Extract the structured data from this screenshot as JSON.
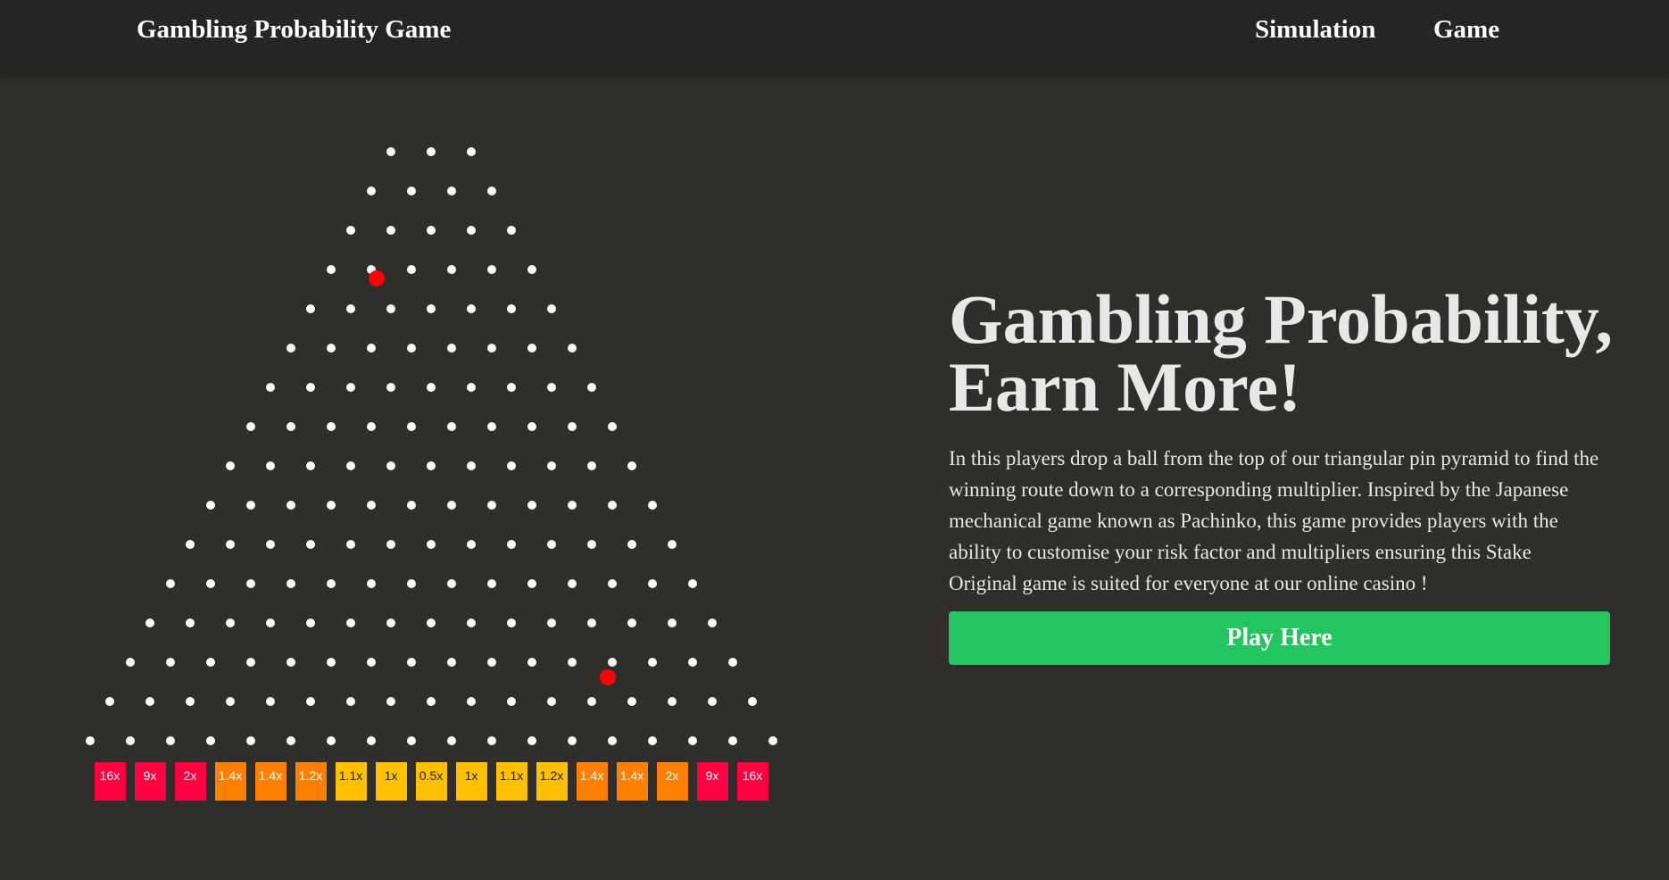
{
  "nav": {
    "brand": "Gambling Probability Game",
    "links": [
      "Simulation",
      "Game"
    ]
  },
  "hero": {
    "title_line1": "Gambling Probability,",
    "title_line2": "Earn More!",
    "description": "In this players drop a ball from the top of our triangular pin pyramid to find the winning route down to a corresponding multiplier. Inspired by the Japanese mechanical game known as Pachinko, this game provides players with the ability to customise your risk factor and multipliers ensuring this Stake Original game is suited for everyone at our online casino !",
    "play_button": "Play Here"
  },
  "board": {
    "rows": 16,
    "pin_color": "#ffffff",
    "ball_color": "#ff0000",
    "ball_count": 2,
    "multipliers": [
      {
        "label": "16x",
        "color": "#ff0040"
      },
      {
        "label": "9x",
        "color": "#ff0040"
      },
      {
        "label": "2x",
        "color": "#ff0040"
      },
      {
        "label": "1.4x",
        "color": "#ff8000"
      },
      {
        "label": "1.4x",
        "color": "#ff8000"
      },
      {
        "label": "1.2x",
        "color": "#ff8000"
      },
      {
        "label": "1.1x",
        "color": "#ffc000"
      },
      {
        "label": "1x",
        "color": "#ffc000"
      },
      {
        "label": "0.5x",
        "color": "#ffc000"
      },
      {
        "label": "1x",
        "color": "#ffc000"
      },
      {
        "label": "1.1x",
        "color": "#ffc000"
      },
      {
        "label": "1.2x",
        "color": "#ffc000"
      },
      {
        "label": "1.4x",
        "color": "#ff8000"
      },
      {
        "label": "1.4x",
        "color": "#ff8000"
      },
      {
        "label": "2x",
        "color": "#ff8000"
      },
      {
        "label": "9x",
        "color": "#ff0040"
      },
      {
        "label": "16x",
        "color": "#ff0040"
      }
    ]
  }
}
